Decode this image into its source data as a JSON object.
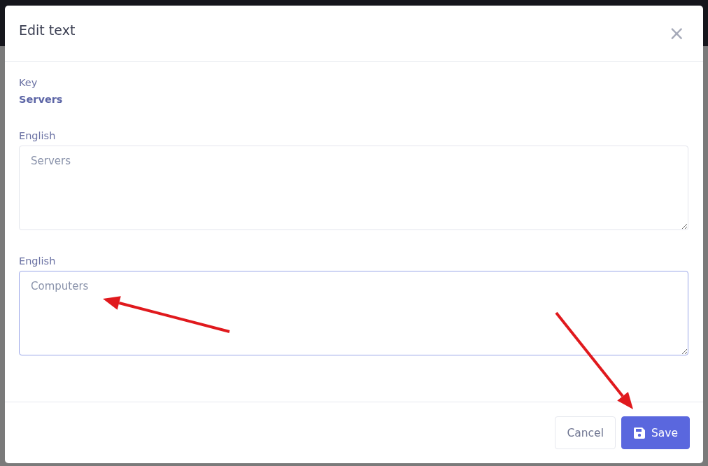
{
  "dialog": {
    "title": "Edit text",
    "close": "×",
    "key": {
      "label": "Key",
      "value": "Servers"
    },
    "fields": [
      {
        "label": "English",
        "value": "Servers",
        "focused": false
      },
      {
        "label": "English",
        "value": "Computers",
        "focused": true
      }
    ],
    "buttons": [
      {
        "kind": "secondary",
        "label": "Cancel"
      },
      {
        "kind": "primary",
        "label": "Save"
      }
    ]
  },
  "annotations": [
    {
      "kind": "arrow"
    },
    {
      "kind": "arrow"
    }
  ]
}
